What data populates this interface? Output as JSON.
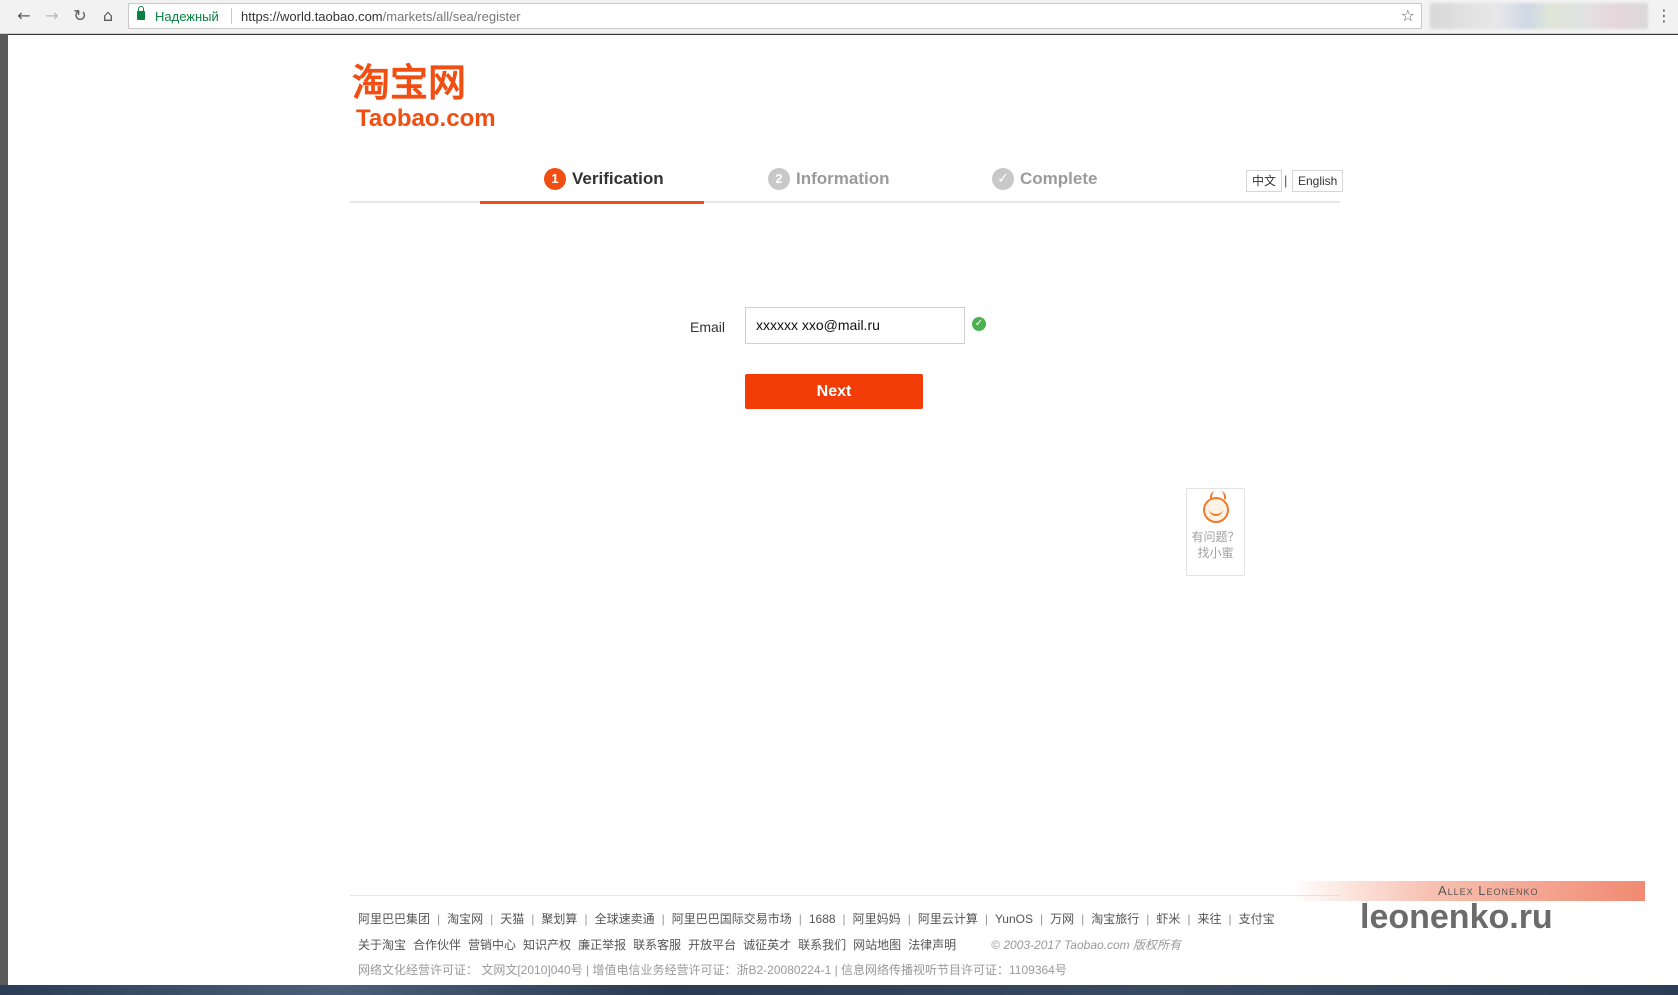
{
  "browser": {
    "secure_label": "Надежный",
    "url_host": "https://world.taobao.com",
    "url_path": "/markets/all/sea/register",
    "icons": [
      "back-arrow-icon",
      "forward-arrow-icon",
      "reload-icon",
      "home-icon",
      "lock-icon",
      "star-icon",
      "menu-icon"
    ]
  },
  "logo": {
    "cn": "淘宝网",
    "en": "Taobao.com"
  },
  "steps": [
    {
      "num": "1",
      "label": "Verification",
      "state": "active"
    },
    {
      "num": "2",
      "label": "Information",
      "state": "inactive"
    },
    {
      "num": "✓",
      "label": "Complete",
      "state": "inactive"
    }
  ],
  "language": {
    "zh": "中文",
    "sep": "|",
    "en": "English"
  },
  "form": {
    "email_label": "Email",
    "email_value": "xxxxxx xxo@mail.ru",
    "next_label": "Next"
  },
  "help": {
    "line1": "有问题？",
    "line2": "找小蜜"
  },
  "footer": {
    "links_row1": [
      "阿里巴巴集团",
      "淘宝网",
      "天猫",
      "聚划算",
      "全球速卖通",
      "阿里巴巴国际交易市场",
      "1688",
      "阿里妈妈",
      "阿里云计算",
      "YunOS",
      "万网",
      "淘宝旅行",
      "虾米",
      "来往",
      "支付宝"
    ],
    "links_row2": [
      "关于淘宝",
      "合作伙伴",
      "营销中心",
      "知识产权",
      "廉正举报",
      "联系客服",
      "开放平台",
      "诚征英才",
      "联系我们",
      "网站地图",
      "法律声明"
    ],
    "copyright": "© 2003-2017 Taobao.com 版权所有",
    "license_row": "网络文化经营许可证： 文网文[2010]040号  |  增值电信业务经营许可证：浙B2-20080224-1  |  信息网络传播视听节目许可证：1109364号"
  },
  "watermark": {
    "name": "Allex Leonenko",
    "site": "leonenko.ru"
  },
  "colors": {
    "brand": "#f04e12",
    "button": "#f23c08",
    "valid": "#4caf50",
    "secure": "#0b8043"
  }
}
